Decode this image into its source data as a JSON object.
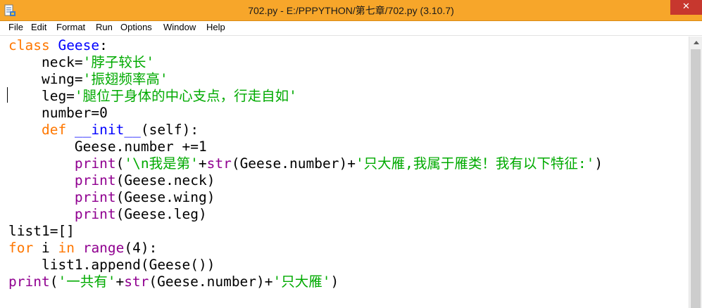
{
  "window": {
    "title": "702.py - E:/PPPYTHON/第七章/702.py (3.10.7)",
    "close_glyph": "✕"
  },
  "menu": [
    "File",
    "Edit",
    "Format",
    "Run",
    "Options",
    "Window",
    "Help"
  ],
  "code": [
    [
      [
        "kw",
        "class"
      ],
      [
        "tx",
        " "
      ],
      [
        "df",
        "Geese"
      ],
      [
        "tx",
        ":"
      ]
    ],
    [
      [
        "tx",
        "    neck="
      ],
      [
        "st",
        "'脖子较长'"
      ]
    ],
    [
      [
        "tx",
        "    wing="
      ],
      [
        "st",
        "'振翅频率高'"
      ]
    ],
    [
      [
        "tx",
        "    leg="
      ],
      [
        "st",
        "'腿位于身体的中心支点，行走自如'"
      ]
    ],
    [
      [
        "tx",
        "    number=0"
      ]
    ],
    [
      [
        "tx",
        "    "
      ],
      [
        "kw",
        "def"
      ],
      [
        "tx",
        " "
      ],
      [
        "df",
        "__init__"
      ],
      [
        "tx",
        "(self):"
      ]
    ],
    [
      [
        "tx",
        "        Geese.number +=1"
      ]
    ],
    [
      [
        "tx",
        "        "
      ],
      [
        "bi",
        "print"
      ],
      [
        "tx",
        "("
      ],
      [
        "st",
        "'\\n我是第'"
      ],
      [
        "tx",
        "+"
      ],
      [
        "bi",
        "str"
      ],
      [
        "tx",
        "(Geese.number)+"
      ],
      [
        "st",
        "'只大雁,我属于雁类！我有以下特征:'"
      ],
      [
        "tx",
        ")"
      ]
    ],
    [
      [
        "tx",
        "        "
      ],
      [
        "bi",
        "print"
      ],
      [
        "tx",
        "(Geese.neck)"
      ]
    ],
    [
      [
        "tx",
        "        "
      ],
      [
        "bi",
        "print"
      ],
      [
        "tx",
        "(Geese.wing)"
      ]
    ],
    [
      [
        "tx",
        "        "
      ],
      [
        "bi",
        "print"
      ],
      [
        "tx",
        "(Geese.leg)"
      ]
    ],
    [
      [
        "tx",
        "list1=[]"
      ]
    ],
    [
      [
        "kw",
        "for"
      ],
      [
        "tx",
        " i "
      ],
      [
        "kw",
        "in"
      ],
      [
        "tx",
        " "
      ],
      [
        "bi",
        "range"
      ],
      [
        "tx",
        "(4):"
      ]
    ],
    [
      [
        "tx",
        "    list1.append(Geese())"
      ]
    ],
    [
      [
        "bi",
        "print"
      ],
      [
        "tx",
        "("
      ],
      [
        "st",
        "'一共有'"
      ],
      [
        "tx",
        "+"
      ],
      [
        "bi",
        "str"
      ],
      [
        "tx",
        "(Geese.number)+"
      ],
      [
        "st",
        "'只大雁'"
      ],
      [
        "tx",
        ")"
      ]
    ]
  ]
}
